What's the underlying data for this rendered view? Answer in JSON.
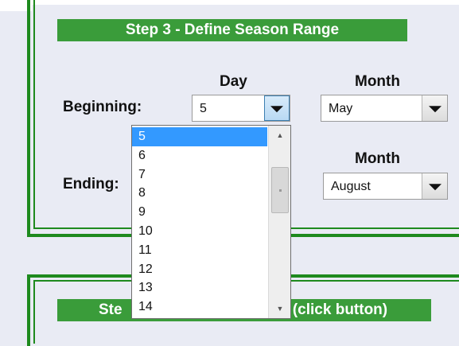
{
  "step3": {
    "title": "Step 3 - Define Season Range",
    "column_day": "Day",
    "column_month": "Month",
    "beginning": {
      "label": "Beginning:",
      "day": "5",
      "month": "May"
    },
    "ending": {
      "label": "Ending:",
      "month": "August"
    }
  },
  "day_dropdown": {
    "selected": "5",
    "options": [
      "5",
      "6",
      "7",
      "8",
      "9",
      "10",
      "11",
      "12",
      "13",
      "14"
    ]
  },
  "step4": {
    "title": "Step 4 - Get Data (click button)",
    "visible_left": "Ste",
    "visible_right": "a (click button)"
  },
  "icons": {
    "dropdown_arrow": "triangle-down-icon",
    "scroll_up": "scroll-up-icon",
    "scroll_down": "scroll-down-icon"
  },
  "colors": {
    "panel_border": "#1e8a1e",
    "banner": "#3a9c3a",
    "selection": "#3399ff",
    "background": "#e9ebf4"
  }
}
